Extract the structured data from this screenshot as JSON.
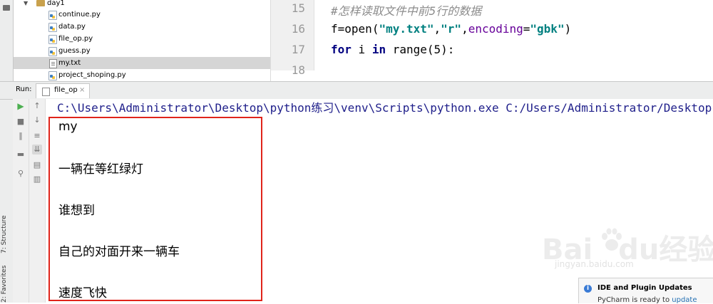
{
  "project_tree": {
    "folder": "day1",
    "files": [
      {
        "name": "continue.py",
        "type": "py",
        "selected": false
      },
      {
        "name": "data.py",
        "type": "py",
        "selected": false
      },
      {
        "name": "file_op.py",
        "type": "py",
        "selected": false
      },
      {
        "name": "guess.py",
        "type": "py",
        "selected": false
      },
      {
        "name": "my.txt",
        "type": "txt",
        "selected": true
      },
      {
        "name": "project_shoping.py",
        "type": "py",
        "selected": false
      }
    ]
  },
  "editor": {
    "lines": [
      {
        "number": "15",
        "comment": "#怎样读取文件中前5行的数据"
      },
      {
        "number": "16",
        "code": {
          "var": "f",
          "eq": "=",
          "func": "open(",
          "arg1": "\"my.txt\"",
          "comma1": ",",
          "arg2": "\"r\"",
          "comma2": ",",
          "param": "encoding",
          "eq2": "=",
          "arg3": "\"gbk\"",
          "close": ")"
        }
      },
      {
        "number": "17",
        "code": {
          "kw_for": "for",
          "var": " i ",
          "kw_in": "in",
          "rest": " range(5):"
        }
      },
      {
        "number": "18"
      }
    ]
  },
  "run_panel": {
    "label": "Run:",
    "tab_name": "file_op",
    "close_glyph": "×"
  },
  "toolbar_icons": [
    "play-icon",
    "stop-icon",
    "pause-icon",
    "layout-icon",
    "pin-icon",
    "up-arrow-icon",
    "down-arrow-icon",
    "soft-wrap-icon",
    "scroll-to-end-icon",
    "print-icon",
    "trash-icon"
  ],
  "console": {
    "command": "C:\\Users\\Administrator\\Desktop\\python练习\\venv\\Scripts\\python.exe C:/Users/Administrator/Desktop",
    "output": [
      "my",
      "一辆在等红绿灯",
      "谁想到",
      "自己的对面开来一辆车",
      "速度飞快"
    ]
  },
  "side_tabs": {
    "structure": "7: Structure",
    "favorites": "2: Favorites"
  },
  "watermark": {
    "brand": "Bai",
    "brand2": "du",
    "brand3": "经验",
    "sub": "jingyan.baidu.com"
  },
  "notification": {
    "title": "IDE and Plugin Updates",
    "body": "PyCharm is ready to ",
    "link": "update"
  },
  "colors": {
    "highlight_box": "#e0241b",
    "keyword": "#000080",
    "string": "#008080"
  }
}
